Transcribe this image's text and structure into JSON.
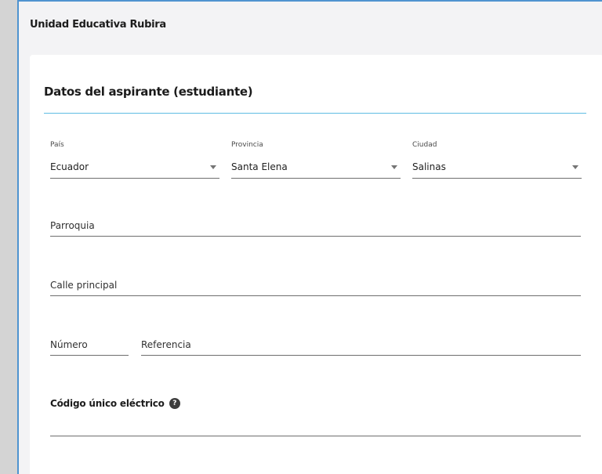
{
  "app": {
    "title": "Unidad Educativa Rubira"
  },
  "section": {
    "title": "Datos del aspirante (estudiante)"
  },
  "location": {
    "country": {
      "label": "País",
      "value": "Ecuador"
    },
    "province": {
      "label": "Provincia",
      "value": "Santa Elena"
    },
    "city": {
      "label": "Ciudad",
      "value": "Salinas"
    }
  },
  "fields": {
    "parish_placeholder": "Parroquia",
    "main_street_placeholder": "Calle principal",
    "number_placeholder": "Número",
    "reference_placeholder": "Referencia"
  },
  "code": {
    "label": "Código único eléctrico",
    "help_glyph": "?"
  },
  "icons": {
    "dropdown": "caret-down-icon",
    "help": "question-circle-icon"
  },
  "colors": {
    "accent": "#5fbde3",
    "frame_border": "#4f93d0",
    "background": "#f3f3f5",
    "card": "#ffffff"
  }
}
